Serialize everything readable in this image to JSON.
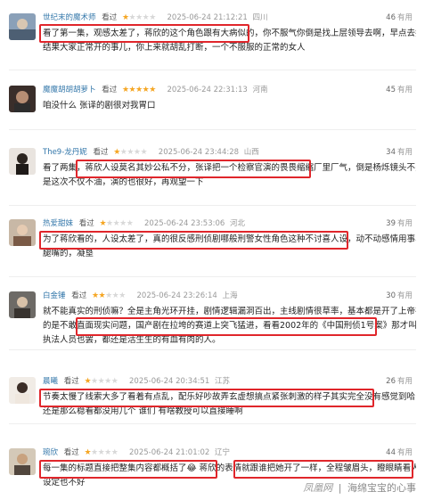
{
  "helpful_label": "有用",
  "reviews": [
    {
      "user": "世纪末的魔术师",
      "status": "看过",
      "stars": 1,
      "time": "2025-06-24 21:12:21",
      "location": "四川",
      "votes": "46",
      "lines": [
        "看了第一集，观感太差了，蒋欣的这个角色跟有大病似的，你不服气你倒是找上层领导去啊，早点去找啊，",
        "结果大家正常开的事儿，你上来就胡乱打断，一个不服服的正常的女人"
      ]
    },
    {
      "user": "魔魔胡胡胡萝卜",
      "status": "看过",
      "stars": 5,
      "time": "2025-06-24 22:31:13",
      "location": "河南",
      "votes": "45",
      "lines": [
        "咱没什么 张译的剧很对我胃口"
      ]
    },
    {
      "user": "The9-龙丹妮",
      "status": "看过",
      "stars": 1,
      "time": "2025-06-24 23:44:28",
      "location": "山西",
      "votes": "34",
      "lines": [
        "看了两集，蒋欣人设莫名其妙公私不分，张译把一个检察官演的畏畏缩缩厂里厂气，倒是杨烁镜头不多，但",
        "是这次不仅不油，演的也很好，再观望一下"
      ]
    },
    {
      "user": "热爱甜妹",
      "status": "看过",
      "stars": 1,
      "time": "2025-06-24 23:53:06",
      "location": "河北",
      "votes": "39",
      "lines": [
        "为了蒋欣看的，人设太差了，真的很反感刑侦剧哪般刑警女性角色这种不讨喜人设，动不动感情用事、拖后",
        "腿嘴的，凝垦"
      ]
    },
    {
      "user": "白金锤",
      "status": "看过",
      "stars": 2,
      "time": "2025-06-24 23:26:14",
      "location": "上海",
      "votes": "30",
      "lines": [
        "就不能真实的刑侦嘛？全是主角光环开挂，剧情逻辑漏洞百出，主线剧情很草率，基本都是开了上帝视角，最最对不起",
        "的是不敢直面现实问题，国产剧在拉垮的赛道上突飞猛进，看看2002年的《中国刑侦1号案》那才叫水准，罪犯也好",
        "执法人员也罢，都还是活生生的有血有肉的人。"
      ]
    },
    {
      "user": "晨曦",
      "status": "看过",
      "stars": 1,
      "time": "2025-06-24 20:34:51",
      "location": "江苏",
      "votes": "26",
      "lines": [
        "节奏太慢了线索大多了看着有点乱，配乐好吵故弄玄虚想搞点紧张刺激的样子其实完全没有感觉到哈 张译演技",
        "还是那么稳看都没用几个 谁们 有啥教授可以直接睡啊"
      ]
    },
    {
      "user": "琬欣",
      "status": "看过",
      "stars": 1,
      "time": "2025-06-24 21:01:02",
      "location": "辽宁",
      "votes": "44",
      "lines": [
        "每一集的标题直接把整集内容都概括了😂 蒋欣的表情就跟谁把她开了一样，全程皱眉头，瞪眼睛看人 角色",
        "设定也不好"
      ]
    }
  ],
  "footer": {
    "brand": "凤凰网",
    "divider": "|",
    "account": "海绵宝宝的心事"
  }
}
